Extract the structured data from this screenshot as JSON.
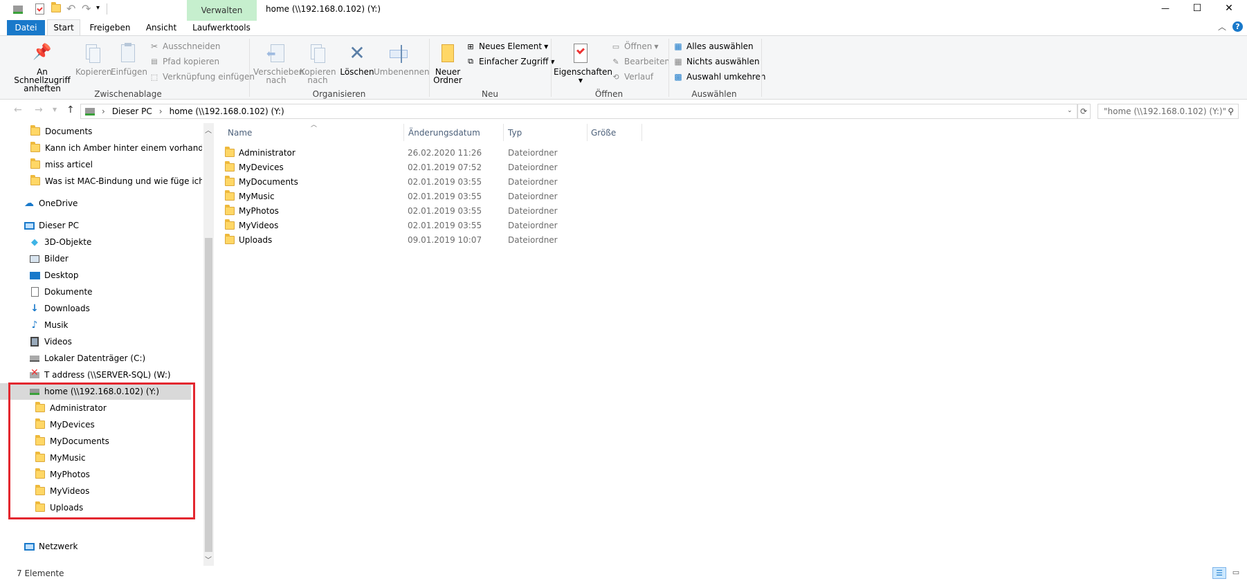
{
  "window": {
    "title": "home (\\\\192.168.0.102) (Y:)",
    "context_tab_group": "Verwalten",
    "minimize_glyph": "—",
    "maximize_glyph": "☐",
    "close_glyph": "✕"
  },
  "ribbon_tabs": [
    {
      "label": "Datei"
    },
    {
      "label": "Start"
    },
    {
      "label": "Freigeben"
    },
    {
      "label": "Ansicht"
    },
    {
      "label": "Laufwerktools"
    }
  ],
  "ribbon": {
    "clipboard": {
      "pin_label": "An Schnellzugriff\nanheften",
      "copy_label": "Kopieren",
      "paste_label": "Einfügen",
      "cut_label": "Ausschneiden",
      "copy_path_label": "Pfad kopieren",
      "paste_shortcut_label": "Verknüpfung einfügen",
      "group_label": "Zwischenablage"
    },
    "organize": {
      "move_label": "Verschieben\nnach",
      "copy_to_label": "Kopieren\nnach",
      "delete_label": "Löschen",
      "rename_label": "Umbenennen",
      "group_label": "Organisieren"
    },
    "new": {
      "new_folder_label": "Neuer\nOrdner",
      "new_item_label": "Neues Element",
      "easy_access_label": "Einfacher Zugriff",
      "group_label": "Neu"
    },
    "open": {
      "properties_label": "Eigenschaften",
      "open_label": "Öffnen",
      "edit_label": "Bearbeiten",
      "history_label": "Verlauf",
      "group_label": "Öffnen"
    },
    "select": {
      "select_all_label": "Alles auswählen",
      "select_none_label": "Nichts auswählen",
      "invert_label": "Auswahl umkehren",
      "group_label": "Auswählen"
    }
  },
  "address": {
    "crumbs": [
      "Dieser PC",
      "home (\\\\192.168.0.102) (Y:)"
    ],
    "search_placeholder": "\"home (\\\\192.168.0.102) (Y:)\" ..."
  },
  "nav": {
    "quick_items": [
      "Documents",
      "Kann ich Amber hinter einem vorhandenen",
      "miss articel",
      "Was ist MAC-Bindung und wie füge ich die"
    ],
    "onedrive": "OneDrive",
    "this_pc": "Dieser PC",
    "pc_items": [
      "3D-Objekte",
      "Bilder",
      "Desktop",
      "Dokumente",
      "Downloads",
      "Musik",
      "Videos",
      "Lokaler Datenträger (C:)",
      "T address (\\\\SERVER-SQL) (W:)",
      "home (\\\\192.168.0.102) (Y:)"
    ],
    "home_children": [
      "Administrator",
      "MyDevices",
      "MyDocuments",
      "MyMusic",
      "MyPhotos",
      "MyVideos",
      "Uploads"
    ],
    "network": "Netzwerk"
  },
  "columns": {
    "name": "Name",
    "date": "Änderungsdatum",
    "type": "Typ",
    "size": "Größe"
  },
  "files": [
    {
      "name": "Administrator",
      "date": "26.02.2020 11:26",
      "type": "Dateiordner"
    },
    {
      "name": "MyDevices",
      "date": "02.01.2019 07:52",
      "type": "Dateiordner"
    },
    {
      "name": "MyDocuments",
      "date": "02.01.2019 03:55",
      "type": "Dateiordner"
    },
    {
      "name": "MyMusic",
      "date": "02.01.2019 03:55",
      "type": "Dateiordner"
    },
    {
      "name": "MyPhotos",
      "date": "02.01.2019 03:55",
      "type": "Dateiordner"
    },
    {
      "name": "MyVideos",
      "date": "02.01.2019 03:55",
      "type": "Dateiordner"
    },
    {
      "name": "Uploads",
      "date": "09.01.2019 10:07",
      "type": "Dateiordner"
    }
  ],
  "status": {
    "count": "7 Elemente"
  },
  "colors": {
    "accent": "#1979ca",
    "verwalten_bg": "#c6efce",
    "highlight_border": "#e3272f",
    "selected_bg": "#d9d9d9"
  }
}
